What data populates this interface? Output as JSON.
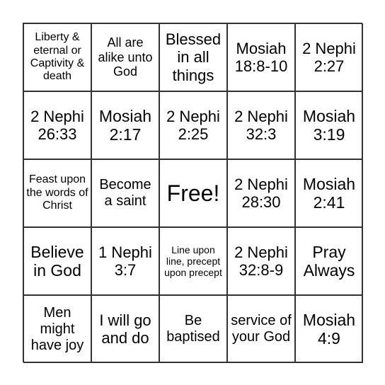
{
  "cells": [
    "Liberty & eternal or Captivity & death",
    "All are alike unto God",
    "Blessed in all things",
    "Mosiah 18:8-10",
    "2 Nephi 2:27",
    "2 Nephi 26:33",
    "Mosiah 2:17",
    "2 Nephi 2:25",
    "2 Nephi 32:3",
    "Mosiah 3:19",
    "Feast upon the words of Christ",
    "Become a saint",
    "Free!",
    "2 Nephi 28:30",
    "Mosiah 2:41",
    "Believe in God",
    "1 Nephi 3:7",
    "Line upon line, precept upon precept",
    "2 Nephi 32:8-9",
    "Pray Always",
    "Men might have joy",
    "I will go and do",
    "Be baptised",
    "service of your God",
    "Mosiah 4:9"
  ]
}
